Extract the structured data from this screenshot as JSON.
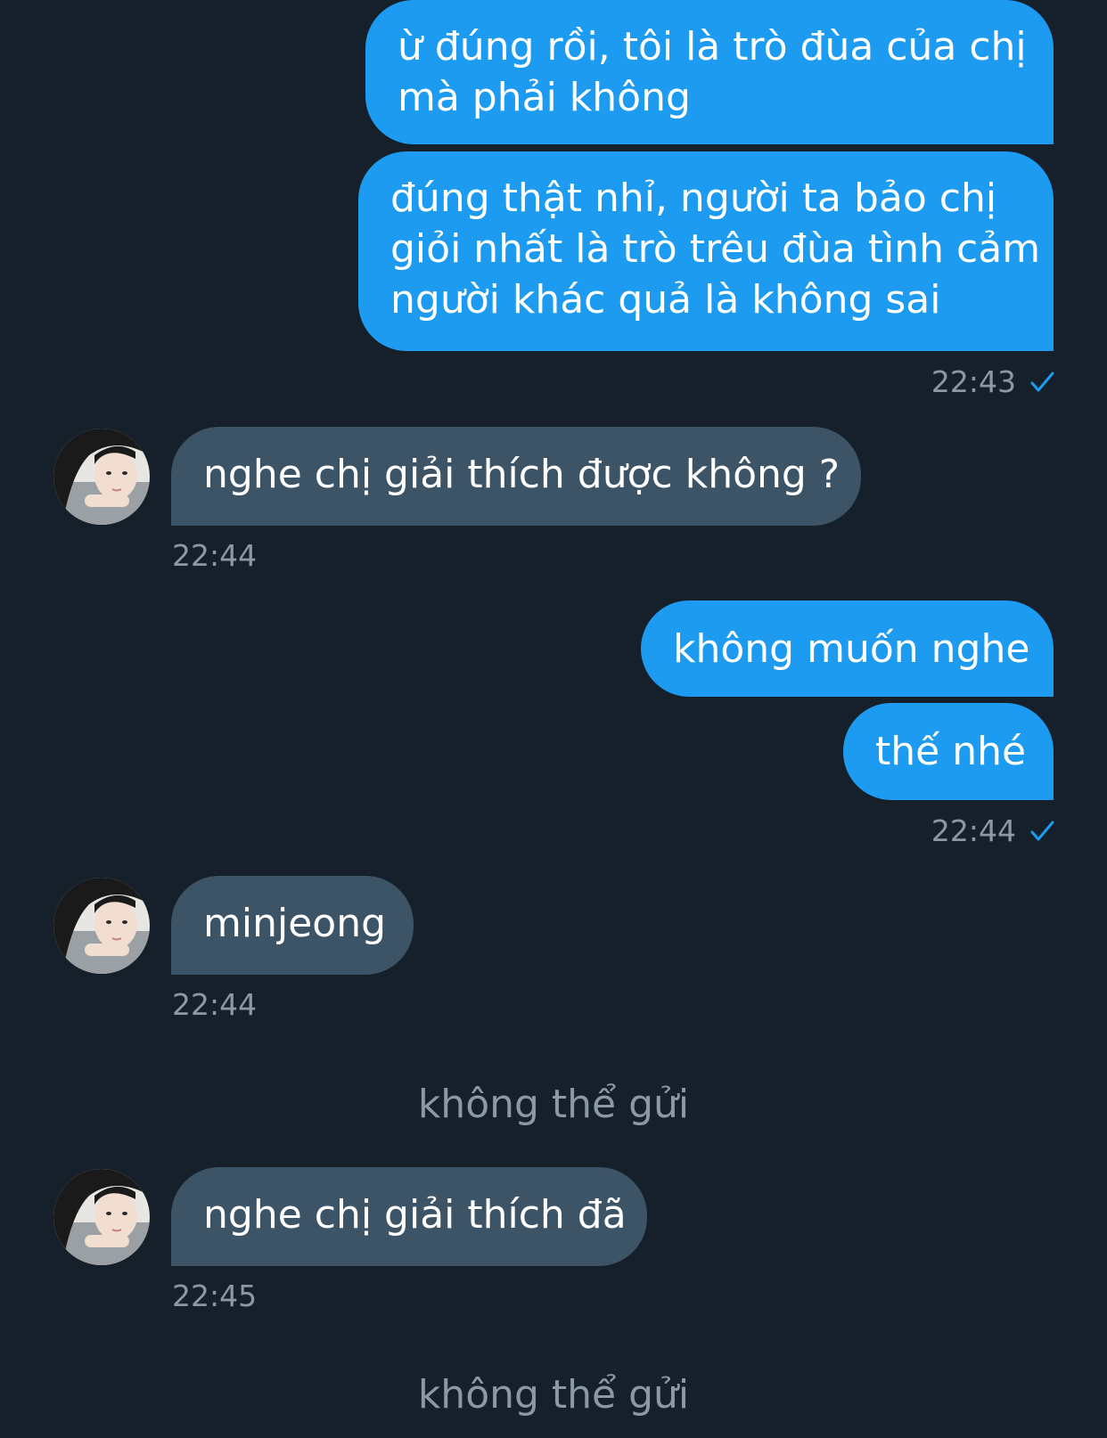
{
  "colors": {
    "background": "#15202b",
    "outgoing_bubble": "#1d9bf0",
    "incoming_bubble": "#3d5466",
    "meta_text": "#8b98a5",
    "check": "#1d9bf0"
  },
  "messages": {
    "m1": {
      "line1": "ừ đúng rồi, tôi là trò đùa của chị",
      "line2": "mà phải không"
    },
    "m2": {
      "line1": "đúng thật nhỉ, người ta bảo chị",
      "line2": "giỏi nhất là trò trêu đùa tình cảm",
      "line3": "người khác quả là không sai",
      "time": "22:43"
    },
    "m3": {
      "text": "nghe chị giải thích được không ?",
      "time": "22:44"
    },
    "m4": {
      "text": "không muốn nghe"
    },
    "m5": {
      "text": "thế nhé",
      "time": "22:44"
    },
    "m6": {
      "text": "minjeong",
      "time": "22:44"
    },
    "sys1": {
      "text": "không thể gửi"
    },
    "m7": {
      "text": "nghe chị giải thích đã",
      "time": "22:45"
    },
    "sys2": {
      "text": "không thể gửi"
    }
  },
  "icons": {
    "read_check": "check-icon",
    "avatar": "contact-avatar"
  }
}
